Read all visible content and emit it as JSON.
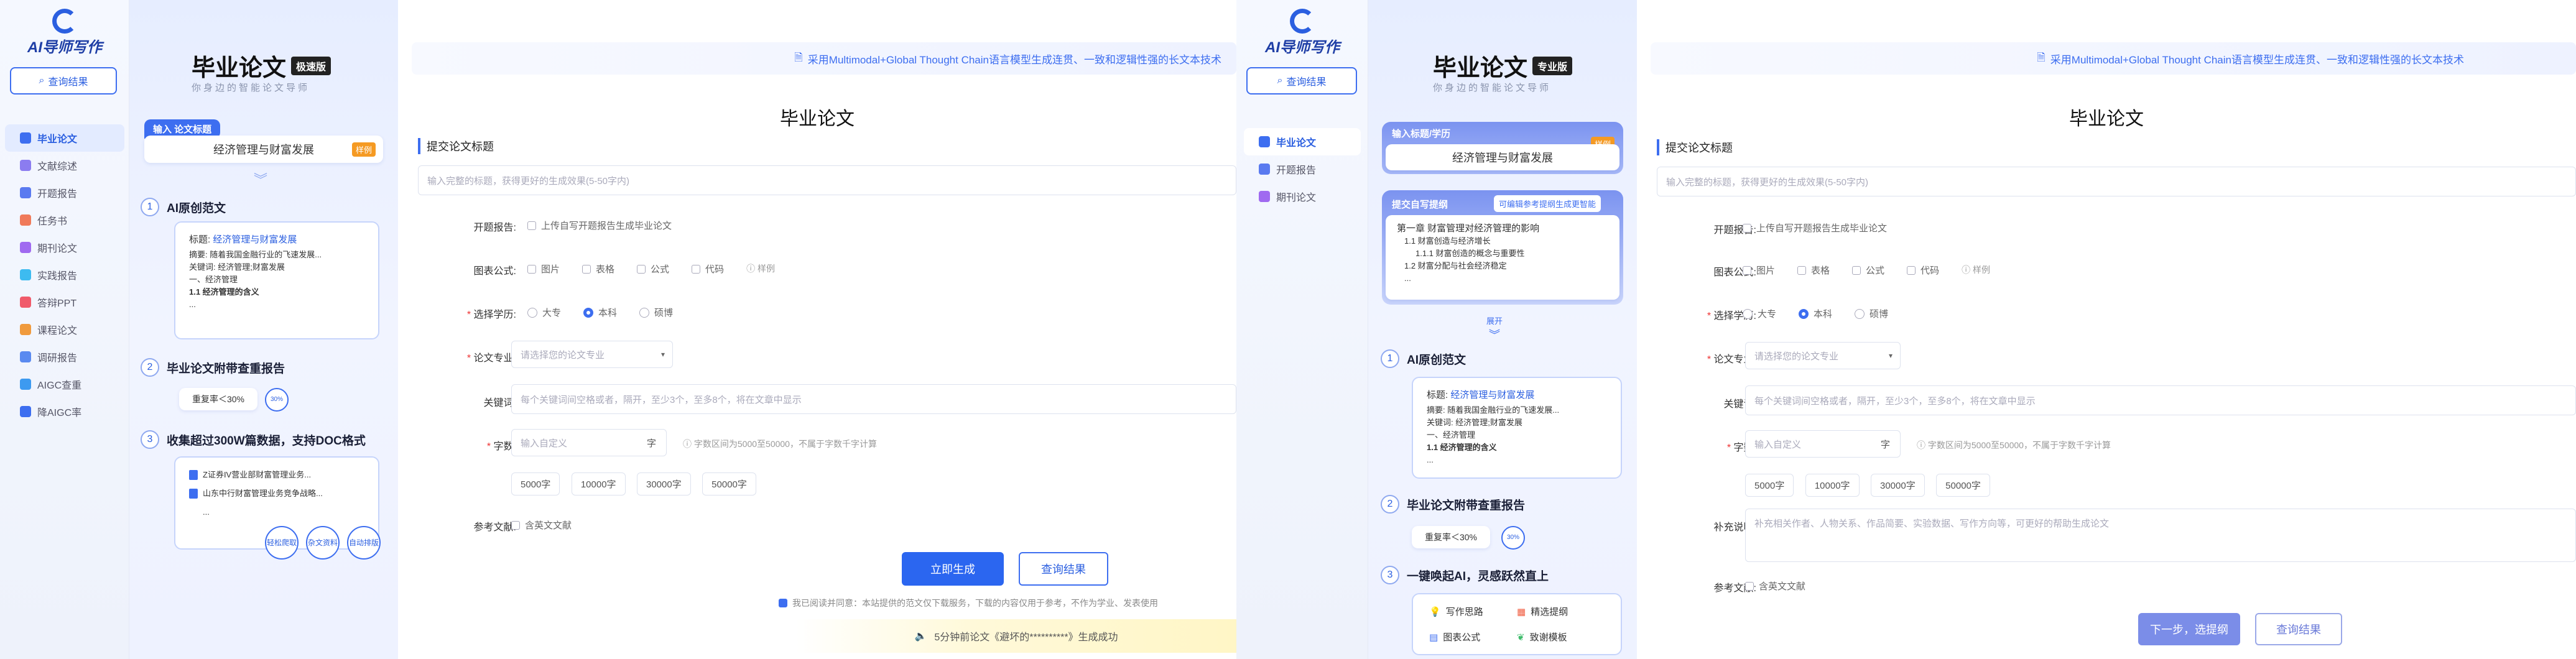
{
  "left": {
    "logo": "AI导师写作",
    "query_btn": "查询结果",
    "nav": [
      "毕业论文",
      "文献综述",
      "开题报告",
      "任务书",
      "期刊论文",
      "实践报告",
      "答辩PPT",
      "课程论文",
      "调研报告",
      "AIGC查重",
      "降AIGC率"
    ]
  },
  "panel1": {
    "title": "毕业论文",
    "badge": "极速版",
    "subtitle": "你身边的智能论文导师",
    "input_tag": "输入 论文标题",
    "title_value": "经济管理与财富发展",
    "example": "样例",
    "step1_num": "1",
    "step1_title": "AI原创范文",
    "card1": {
      "title_lbl": "标题:",
      "title_val": "经济管理与财富发展",
      "abstract": "摘要: 随着我国金融行业的飞速发展...",
      "keywords": "关键词: 经济管理;财富发展",
      "l1": "一、经济管理",
      "l2": "1.1 经济管理的含义",
      "l3": "..."
    },
    "step2_num": "2",
    "step2_title": "毕业论文附带查重报告",
    "rate": "重复率＜30%",
    "rate_circle": "30%",
    "step3_num": "3",
    "step3_title": "收集超过300W篇数据，支持DOC格式",
    "docs": [
      "Z证券IV营业部财富管理业务...",
      "山东中行财富管理业务竞争战略...",
      "..."
    ],
    "circles": [
      "轻松爬取",
      "杂文资料",
      "自动排版"
    ]
  },
  "form1": {
    "banner": "采用Multimodal+Global Thought Chain语言模型生成连贯、一致和逻辑性强的长文本技术",
    "heading": "毕业论文",
    "section": "提交论文标题",
    "title_placeholder": "输入完整的标题，获得更好的生成效果(5-50字内)",
    "opening_lbl": "开题报告:",
    "opening_opt": "上传自写开题报告生成毕业论文",
    "chart_lbl": "图表公式:",
    "chart_opts": [
      "图片",
      "表格",
      "公式",
      "代码"
    ],
    "chart_example": "样例",
    "edu_lbl": "选择学历:",
    "edu_opts": [
      "大专",
      "本科",
      "硕博"
    ],
    "major_lbl": "论文专业:",
    "major_placeholder": "请选择您的论文专业",
    "kw_lbl": "关键词:",
    "kw_placeholder": "每个关键词间空格或者，隔开，至少3个，至多8个，将在文章中显示",
    "words_lbl": "字数:",
    "words_placeholder": "输入自定义",
    "words_unit": "字",
    "words_hint": "字数区间为5000至50000，不属于字数千字计算",
    "word_chips": [
      "5000字",
      "10000字",
      "30000字",
      "50000字"
    ],
    "ref_lbl": "参考文献:",
    "ref_opt": "含英文文献",
    "gen_btn": "立即生成",
    "query_btn": "查询结果",
    "agree": "我已阅读并同意：本站提供的范文仅下载服务，下载的内容仅用于参考，不作为学业、发表使用",
    "notice": "5分钟前论文《避坏的**********》生成成功"
  },
  "nav2": {
    "logo": "AI导师写作",
    "query_btn": "查询结果",
    "items": [
      "毕业论文",
      "开题报告",
      "期刊论文"
    ]
  },
  "panel2": {
    "title": "毕业论文",
    "badge": "专业版",
    "subtitle": "你身边的智能论文导师",
    "input_tag": "输入标题/学历",
    "example": "样例",
    "title_value": "经济管理与财富发展",
    "outline_tag": "提交自写提纲",
    "outline_hint": "可编辑参考提纲生成更智能",
    "outline": [
      "第一章 财富管理对经济管理的影响",
      "1.1 财富创造与经济增长",
      "1.1.1 财富创造的概念与重要性",
      "1.2 财富分配与社会经济稳定",
      "..."
    ],
    "expand": "展开",
    "step1_num": "1",
    "step1_title": "AI原创范文",
    "card": {
      "title_lbl": "标题:",
      "title_val": "经济管理与财富发展",
      "abstract": "摘要: 随着我国金融行业的飞速发展...",
      "keywords": "关键词: 经济管理;财富发展",
      "l1": "一、经济管理",
      "l2": "1.1 经济管理的含义",
      "l3": "..."
    },
    "step2_num": "2",
    "step2_title": "毕业论文附带查重报告",
    "rate": "重复率＜30%",
    "rate_circle": "30%",
    "step3_num": "3",
    "step3_title": "一键唤起AI，灵感跃然直上",
    "feats": [
      "写作思路",
      "精选提纲",
      "图表公式",
      "致谢模板"
    ]
  },
  "form2": {
    "banner": "采用Multimodal+Global Thought Chain语言模型生成连贯、一致和逻辑性强的长文本技术",
    "heading": "毕业论文",
    "section": "提交论文标题",
    "title_placeholder": "输入完整的标题，获得更好的生成效果(5-50字内)",
    "opening_lbl": "开题报告:",
    "opening_opt": "上传自写开题报告生成毕业论文",
    "chart_lbl": "图表公式:",
    "chart_opts": [
      "图片",
      "表格",
      "公式",
      "代码"
    ],
    "chart_example": "样例",
    "edu_lbl": "选择学历:",
    "edu_opts": [
      "大专",
      "本科",
      "硕博"
    ],
    "major_lbl": "论文专业:",
    "major_placeholder": "请选择您的论文专业",
    "kw_lbl": "关键词:",
    "kw_placeholder": "每个关键词间空格或者，隔开，至少3个，至多8个，将在文章中显示",
    "words_lbl": "字数:",
    "words_placeholder": "输入自定义",
    "words_unit": "字",
    "words_hint": "字数区间为5000至50000，不属于字数千字计算",
    "word_chips": [
      "5000字",
      "10000字",
      "30000字",
      "50000字"
    ],
    "extra_lbl": "补充说明:",
    "extra_placeholder": "补充相关作者、人物关系、作品简要、实验数据、写作方向等，可更好的帮助生成论文",
    "ref_lbl": "参考文献:",
    "ref_opt": "含英文文献",
    "next_btn": "下一步，选提纲",
    "query_btn": "查询结果"
  }
}
